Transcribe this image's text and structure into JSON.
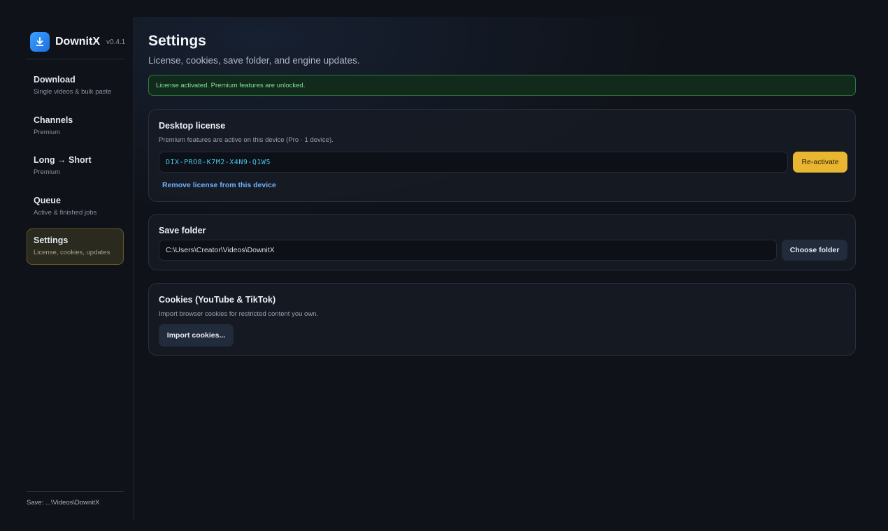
{
  "brand": {
    "name": "DownitX",
    "version": "v0.4.1"
  },
  "sidebar": {
    "items": [
      {
        "label": "Download",
        "sub": "Single videos & bulk paste"
      },
      {
        "label": "Channels",
        "sub": "Premium"
      },
      {
        "label": "Long → Short",
        "sub": "Premium"
      },
      {
        "label": "Queue",
        "sub": "Active & finished jobs"
      },
      {
        "label": "Settings",
        "sub": "License, cookies, updates"
      }
    ],
    "footer": "Save: ...\\Videos\\DownitX"
  },
  "page": {
    "title": "Settings",
    "subtitle": "License, cookies, save folder, and engine updates."
  },
  "alert": {
    "text": "License activated. Premium features are unlocked."
  },
  "license": {
    "title": "Desktop license",
    "desc": "Premium features are active on this device (Pro · 1 device).",
    "key": "DIX-PRO8-K7M2-X4N9-Q1W5",
    "reactivate_label": "Re-activate",
    "remove_label": "Remove license from this device"
  },
  "save_folder": {
    "title": "Save folder",
    "path": "C:\\Users\\Creator\\Videos\\DownitX",
    "choose_label": "Choose folder"
  },
  "cookies": {
    "title": "Cookies (YouTube & TikTok)",
    "desc": "Import browser cookies for restricted content you own.",
    "import_label": "Import cookies..."
  },
  "colors": {
    "accent": "#e9b632",
    "success": "#7fe29a",
    "link": "#6fb2ff",
    "key": "#46c4e8"
  }
}
